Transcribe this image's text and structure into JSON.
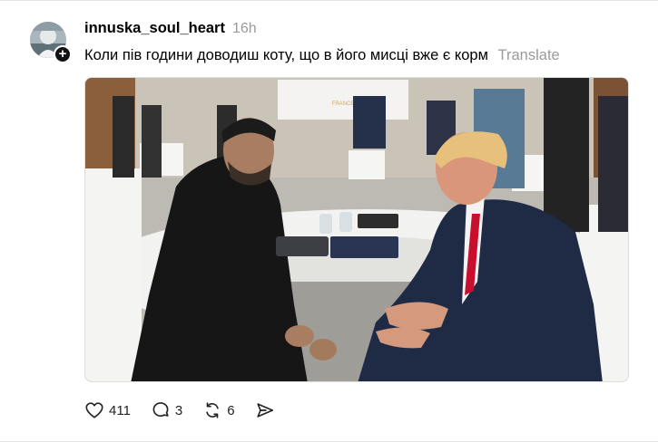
{
  "post": {
    "username": "innuska_soul_heart",
    "time": "16h",
    "caption": "Коли пів години доводиш коту, що в його мисці вже є корм",
    "translate_label": "Translate",
    "follow_badge": "+"
  },
  "photo": {
    "banner_text": "FRANCE"
  },
  "actions": {
    "like_count": "411",
    "comment_count": "3",
    "repost_count": "6"
  },
  "colors": {
    "tie_red": "#c8102e",
    "muted_text": "#9a9a9a"
  },
  "icons": [
    "heart-icon",
    "comment-icon",
    "repost-icon",
    "share-icon",
    "plus-icon"
  ]
}
